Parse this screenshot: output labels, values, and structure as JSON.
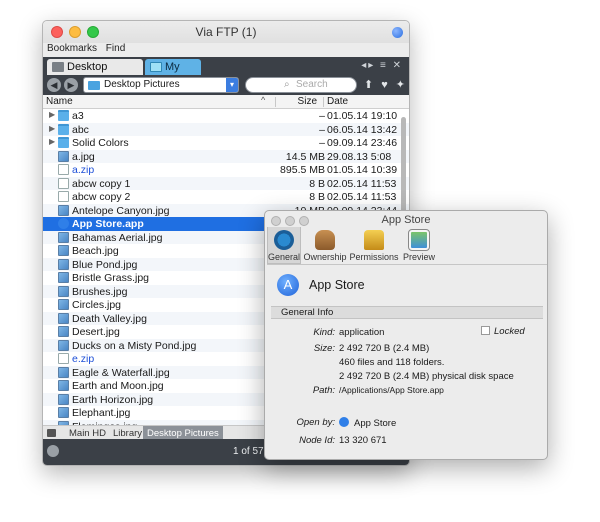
{
  "window": {
    "title": "Via FTP (1)",
    "menu": [
      "Bookmarks",
      "Find"
    ],
    "tabs": [
      {
        "label": "Desktop Pictures"
      },
      {
        "label": "My FTP"
      }
    ],
    "path_select": "Desktop Pictures",
    "search_placeholder": "Search",
    "columns": {
      "name": "Name",
      "size": "Size",
      "date": "Date"
    },
    "files": [
      {
        "name": "a3",
        "size": "–",
        "date": "01.05.14 19:10",
        "kind": "folder"
      },
      {
        "name": "abc",
        "size": "–",
        "date": "06.05.14 13:42",
        "kind": "folder"
      },
      {
        "name": "Solid Colors",
        "size": "–",
        "date": "09.09.14 23:46",
        "kind": "folder"
      },
      {
        "name": "a.jpg",
        "size": "14.5 MB",
        "date": "29.08.13 5:08",
        "kind": "img"
      },
      {
        "name": "a.zip",
        "size": "895.5 MB",
        "date": "01.05.14 10:39",
        "kind": "zip"
      },
      {
        "name": "abcw copy 1",
        "size": "8 B",
        "date": "02.05.14 11:53",
        "kind": "doc"
      },
      {
        "name": "abcw copy 2",
        "size": "8 B",
        "date": "02.05.14 11:53",
        "kind": "doc"
      },
      {
        "name": "Antelope Canyon.jpg",
        "size": "10 MB",
        "date": "09.09.14 23:44",
        "kind": "img"
      },
      {
        "name": "App Store.app",
        "size": "",
        "date": "",
        "kind": "app"
      },
      {
        "name": "Bahamas Aerial.jpg",
        "size": "",
        "date": "",
        "kind": "img"
      },
      {
        "name": "Beach.jpg",
        "size": "",
        "date": "",
        "kind": "img"
      },
      {
        "name": "Blue Pond.jpg",
        "size": "",
        "date": "",
        "kind": "img"
      },
      {
        "name": "Bristle Grass.jpg",
        "size": "",
        "date": "",
        "kind": "img"
      },
      {
        "name": "Brushes.jpg",
        "size": "",
        "date": "",
        "kind": "img"
      },
      {
        "name": "Circles.jpg",
        "size": "",
        "date": "",
        "kind": "img"
      },
      {
        "name": "Death Valley.jpg",
        "size": "",
        "date": "",
        "kind": "img"
      },
      {
        "name": "Desert.jpg",
        "size": "",
        "date": "",
        "kind": "img"
      },
      {
        "name": "Ducks on a Misty Pond.jpg",
        "size": "",
        "date": "",
        "kind": "img"
      },
      {
        "name": "e.zip",
        "size": "",
        "date": "",
        "kind": "zip"
      },
      {
        "name": "Eagle & Waterfall.jpg",
        "size": "",
        "date": "",
        "kind": "img"
      },
      {
        "name": "Earth and Moon.jpg",
        "size": "",
        "date": "",
        "kind": "img"
      },
      {
        "name": "Earth Horizon.jpg",
        "size": "",
        "date": "",
        "kind": "img"
      },
      {
        "name": "Elephant.jpg",
        "size": "",
        "date": "",
        "kind": "img"
      },
      {
        "name": "Flamingos.jpg",
        "size": "",
        "date": "",
        "kind": "img"
      }
    ],
    "pathbar": [
      "Main HD",
      "Library",
      "Desktop Pictures"
    ],
    "status": "1 of 57 ("
  },
  "info": {
    "title": "App Store",
    "tabs": [
      "General",
      "Ownership",
      "Permissions",
      "Preview"
    ],
    "app_name": "App Store",
    "section": "General Info",
    "kind_label": "Kind:",
    "kind": "application",
    "locked_label": "Locked",
    "size_label": "Size:",
    "size_1": "2 492 720 B (2.4 MB)",
    "size_2": "460 files and 118 folders.",
    "size_3": "2 492 720 B (2.4 MB) physical disk space",
    "path_label": "Path:",
    "path": "/Applications/App Store.app",
    "openby_label": "Open by:",
    "openby": "App Store",
    "node_label": "Node Id:",
    "node": "13 320 671"
  }
}
